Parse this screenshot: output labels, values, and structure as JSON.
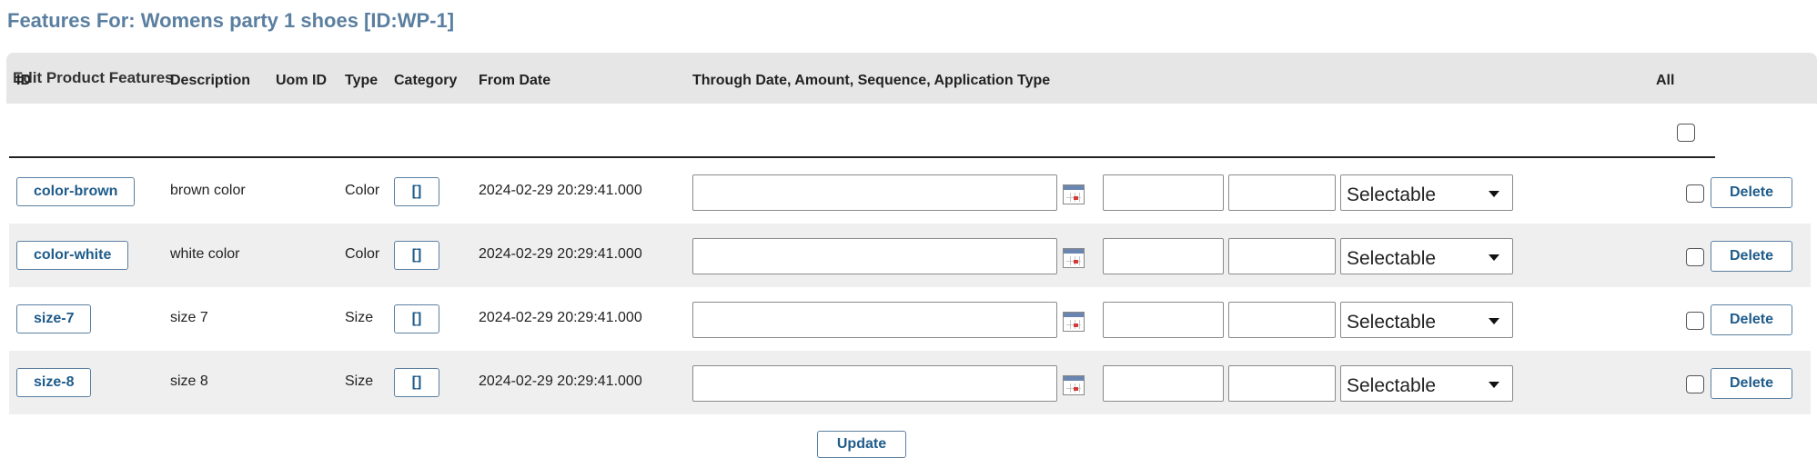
{
  "page_title": "Features For: Womens party 1 shoes [ID:WP-1]",
  "panel": {
    "title": "Edit Product Features"
  },
  "table": {
    "headers": {
      "id": "ID",
      "description": "Description",
      "uom_id": "Uom ID",
      "type": "Type",
      "category": "Category",
      "from_date": "From Date",
      "through": "Through Date, Amount, Sequence, Application Type",
      "all": "All"
    },
    "rows": [
      {
        "id": "color-brown",
        "description": "brown color",
        "type": "Color",
        "category": "[]",
        "from_date": "2024-02-29 20:29:41.000",
        "through_date": "",
        "amount": "",
        "sequence": "",
        "application_type": "Selectable",
        "delete": "Delete"
      },
      {
        "id": "color-white",
        "description": "white color",
        "type": "Color",
        "category": "[]",
        "from_date": "2024-02-29 20:29:41.000",
        "through_date": "",
        "amount": "",
        "sequence": "",
        "application_type": "Selectable",
        "delete": "Delete"
      },
      {
        "id": "size-7",
        "description": "size 7",
        "type": "Size",
        "category": "[]",
        "from_date": "2024-02-29 20:29:41.000",
        "through_date": "",
        "amount": "",
        "sequence": "",
        "application_type": "Selectable",
        "delete": "Delete"
      },
      {
        "id": "size-8",
        "description": "size 8",
        "type": "Size",
        "category": "[]",
        "from_date": "2024-02-29 20:29:41.000",
        "through_date": "",
        "amount": "",
        "sequence": "",
        "application_type": "Selectable",
        "delete": "Delete"
      }
    ]
  },
  "update_label": "Update",
  "colors": {
    "title": "#5B7FA0",
    "header_bg": "#e6e6e6",
    "alt_row": "#efefef",
    "button_text": "#1f5c8a"
  }
}
